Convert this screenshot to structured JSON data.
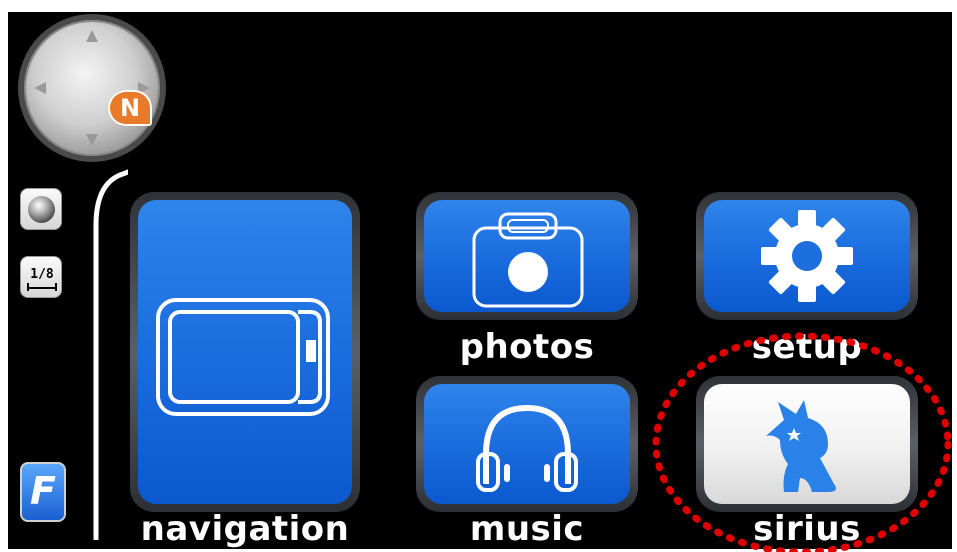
{
  "side_controls": {
    "compass": {
      "badge": "N"
    },
    "scale_label": "1/8",
    "brand_letter": "F"
  },
  "menu": {
    "tiles": [
      {
        "label": "navigation",
        "icon": "screen-outline-icon"
      },
      {
        "label": "photos",
        "icon": "camera-icon"
      },
      {
        "label": "setup",
        "icon": "gear-icon"
      },
      {
        "label": "music",
        "icon": "headphones-icon"
      },
      {
        "label": "sirius",
        "icon": "sirius-dog-icon",
        "selected_style": "white"
      }
    ]
  },
  "colors": {
    "tile_blue": "#1d6fe0",
    "badge_orange": "#e87a2a",
    "highlight_red": "#e00000",
    "background": "#000000"
  },
  "annotation": {
    "style": "red-dotted-circle",
    "target": "sirius"
  }
}
